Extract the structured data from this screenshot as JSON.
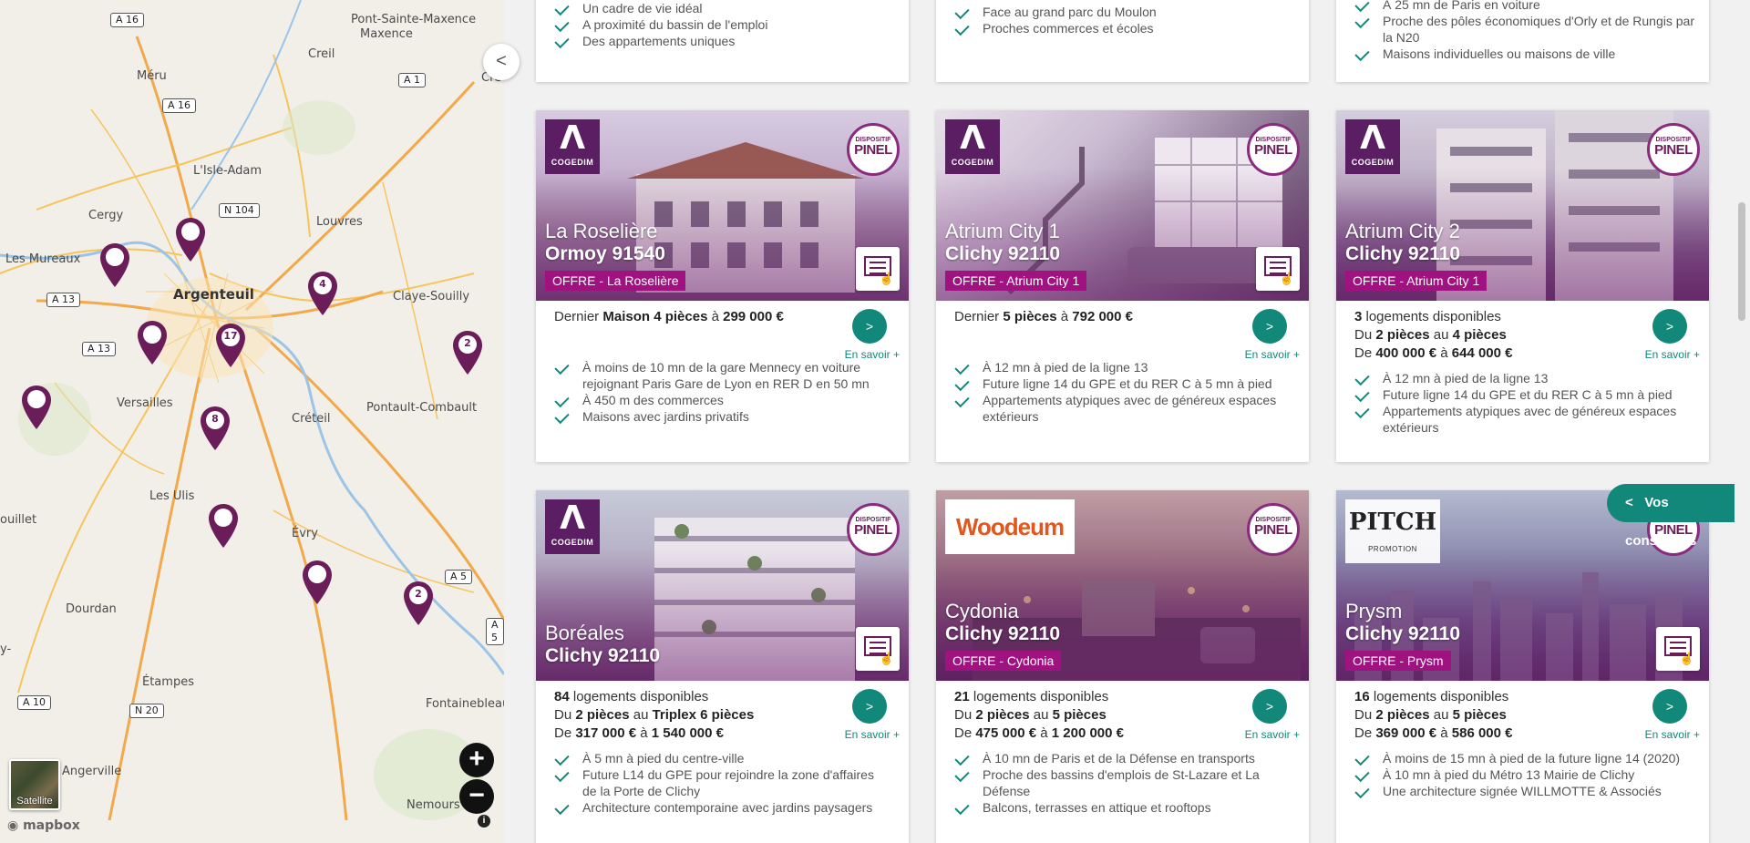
{
  "map": {
    "collapse_label": "<",
    "zoom_in": "+",
    "zoom_out": "−",
    "satellite_label": "Satellite",
    "attribution": "mapbox",
    "info": "i",
    "cities": [
      "Pont-Sainte-Maxence",
      "Creil",
      "Méru",
      "Cre",
      "L'Isle-Adam",
      "Cergy",
      "Louvres",
      "Les Mureaux",
      "Argenteuil",
      "Claye-Souilly",
      "Versailles",
      "Pontault-Combault",
      "Créteil",
      "Les Ulis",
      "Évry",
      "ouillet",
      "Dourdan",
      "Étampes",
      "Fontainebleau",
      "Angerville",
      "Nemours",
      "y-"
    ],
    "roads": [
      "A 16",
      "A 1",
      "A 16",
      "N 104",
      "A 13",
      "A 13",
      "A 5",
      "A 5",
      "A 10",
      "N 20"
    ],
    "clusters": [
      "4",
      "17",
      "2",
      "8",
      "2"
    ]
  },
  "top_row": [
    [
      "Un cadre de vie idéal",
      "A proximité du bassin de l'emploi",
      "Des appartements uniques"
    ],
    [
      "Face au grand parc du Moulon",
      "Proches commerces et écoles"
    ],
    [
      "À 25 mn de Paris en voiture",
      "Proche des pôles économiques d'Orly et de Rungis par la N20",
      "Maisons individuelles ou maisons de ville"
    ]
  ],
  "common": {
    "pinel_a": "DISPOSITIF",
    "pinel_b": "PINEL",
    "cogedim": "COGEDIM",
    "go": ">",
    "more": "En savoir +"
  },
  "cards": [
    {
      "name": "La Roselière",
      "city": "Ormoy 91540",
      "offer": "OFFRE - La Roselière",
      "s1": [
        "Dernier ",
        "Maison 4 pièces",
        " à ",
        "299 000 €"
      ],
      "features": [
        "À moins de 10 mn de la gare Mennecy en voiture rejoignant Paris Gare de Lyon en RER D en 50 mn",
        "À 450 m des commerces",
        "Maisons avec jardins privatifs"
      ]
    },
    {
      "name": "Atrium City 1",
      "city": "Clichy 92110",
      "offer": "OFFRE - Atrium City 1",
      "s1": [
        "Dernier ",
        "5 pièces",
        " à ",
        "792 000 €"
      ],
      "features": [
        "À 12 mn à pied de la ligne 13",
        "Future ligne 14 du GPE et du RER C à 5 mn à pied",
        "Appartements atypiques avec de généreux espaces extérieurs"
      ]
    },
    {
      "name": "Atrium City 2",
      "city": "Clichy 92110",
      "offer": "OFFRE - Atrium City 1",
      "count": "3",
      "count_label": " logements disponibles",
      "from_label": "Du ",
      "from": "2 pièces",
      "to_label": " au ",
      "to": "4 pièces",
      "pfrom_label": "De ",
      "pfrom": "400 000 €",
      "pto_label": " à ",
      "pto": "644 000 €",
      "features": [
        "À 12 mn à pied de la ligne 13",
        "Future ligne 14 du GPE et du RER C à 5 mn à pied",
        "Appartements atypiques avec de généreux espaces extérieurs"
      ]
    },
    {
      "name": "Boréales",
      "city": "Clichy 92110",
      "count": "84",
      "count_label": " logements disponibles",
      "from_label": "Du ",
      "from": "2 pièces",
      "to_label": " au ",
      "to": "Triplex 6 pièces",
      "pfrom_label": "De ",
      "pfrom": "317 000 €",
      "pto_label": " à ",
      "pto": "1 540 000 €",
      "features": [
        "À 5 mn à pied du centre-ville",
        "Future L14 du GPE pour rejoindre la zone d'affaires de la Porte de Clichy",
        "Architecture contemporaine avec jardins paysagers"
      ]
    },
    {
      "name": "Cydonia",
      "city": "Clichy 92110",
      "offer": "OFFRE - Cydonia",
      "brand": "Woodeum",
      "count": "21",
      "count_label": " logements disponibles",
      "from_label": "Du ",
      "from": "2 pièces",
      "to_label": " au ",
      "to": "5 pièces",
      "pfrom_label": "De ",
      "pfrom": "475 000 €",
      "pto_label": " à ",
      "pto": "1 200 000 €",
      "features": [
        "À 10 mn de Paris et de la Défense en transports",
        "Proche des bassins d'emplois de St-Lazare et La Défense",
        "Balcons, terrasses en attique et rooftops"
      ]
    },
    {
      "name": "Prysm",
      "city": "Clichy 92110",
      "offer": "OFFRE - Prysm",
      "brand": "PITCH",
      "brand_sub": "PROMOTION",
      "count": "16",
      "count_label": " logements disponibles",
      "from_label": "Du ",
      "from": "2 pièces",
      "to_label": " au ",
      "to": "5 pièces",
      "pfrom_label": "De ",
      "pfrom": "369 000 €",
      "pto_label": " à ",
      "pto": "586 000 €",
      "features": [
        "À moins de 15 mn à pied de la future ligne 14 (2020)",
        "À 10 mn à pied du Métro 13 Mairie de Clichy",
        "Une architecture signée WILLMOTTE & Associés"
      ]
    }
  ],
  "advisors": {
    "arrow": "<",
    "label": "Vos conseillers"
  }
}
